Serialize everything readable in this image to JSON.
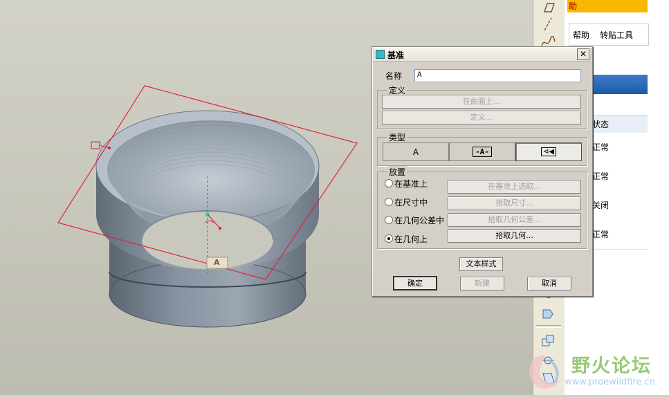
{
  "dialog": {
    "title": "基准",
    "close": "✕",
    "name_label": "名称",
    "name_value": "A",
    "define_group": "定义",
    "on_surface_button": "在曲面上...",
    "define_button": "定义...",
    "type_group": "类型",
    "type_options": [
      "A",
      "-A-",
      "⊲◀"
    ],
    "type_selected_index": 2,
    "placement_group": "放置",
    "placement_options": [
      {
        "label": "在基准上",
        "button": "在基准上选取...",
        "selected": false,
        "enabled": false
      },
      {
        "label": "在尺寸中",
        "button": "拾取尺寸...",
        "selected": false,
        "enabled": false
      },
      {
        "label": "在几何公差中",
        "button": "拾取几何公差...",
        "selected": false,
        "enabled": false
      },
      {
        "label": "在几何上",
        "button": "拾取几何...",
        "selected": true,
        "enabled": true
      }
    ],
    "text_style_button": "文本样式",
    "ok_button": "确定",
    "new_button": "新建",
    "cancel_button": "取消"
  },
  "right_panel": {
    "banner_text": "助",
    "menu_items": [
      "帮助",
      "转贴工具"
    ],
    "status_header": "状态",
    "status_rows": [
      "正常",
      "正常",
      "关闭",
      "正常"
    ],
    "colors": {
      "banner": "#f7b800",
      "header_bar": "#2a65b5"
    }
  },
  "model": {
    "datum_tag": "A"
  },
  "watermark": {
    "title": "野火论坛",
    "url": "www.proewildfire.cn"
  },
  "toolbar_icons": [
    "plane-icon",
    "axis-icon",
    "curve-icon",
    "cube-icon",
    "copy-icon",
    "mirror-icon",
    "move-icon"
  ]
}
